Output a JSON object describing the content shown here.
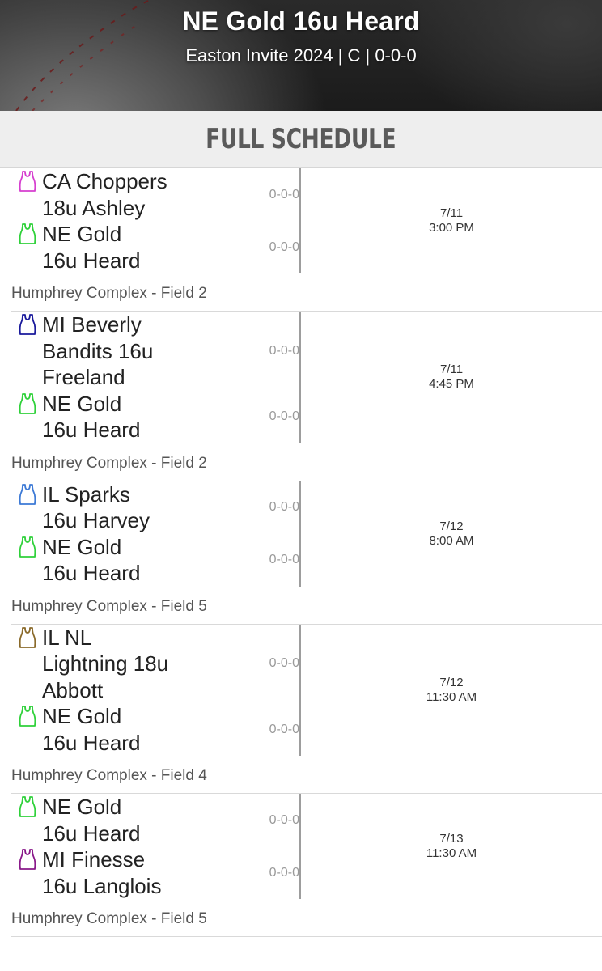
{
  "header": {
    "title": "NE Gold 16u Heard",
    "subtitle": "Easton Invite 2024 | C | 0-0-0"
  },
  "section": {
    "title": "FULL SCHEDULE"
  },
  "games": [
    {
      "teams": [
        {
          "name_lines": [
            "CA Choppers",
            "18u Ashley"
          ],
          "record": "0-0-0",
          "jersey_color": "#d63fcf"
        },
        {
          "name_lines": [
            "NE Gold",
            "16u Heard"
          ],
          "record": "0-0-0",
          "jersey_color": "#2fd13a"
        }
      ],
      "date": "7/11",
      "time": "3:00 PM",
      "location": "Humphrey Complex - Field 2"
    },
    {
      "teams": [
        {
          "name_lines": [
            "MI Beverly",
            "Bandits 16u",
            "Freeland"
          ],
          "record": "0-0-0",
          "jersey_color": "#1a1a9c"
        },
        {
          "name_lines": [
            "NE Gold",
            "16u Heard"
          ],
          "record": "0-0-0",
          "jersey_color": "#2fd13a"
        }
      ],
      "date": "7/11",
      "time": "4:45 PM",
      "location": "Humphrey Complex - Field 2"
    },
    {
      "teams": [
        {
          "name_lines": [
            "IL Sparks",
            "16u Harvey"
          ],
          "record": "0-0-0",
          "jersey_color": "#3d7ad6"
        },
        {
          "name_lines": [
            "NE Gold",
            "16u Heard"
          ],
          "record": "0-0-0",
          "jersey_color": "#2fd13a"
        }
      ],
      "date": "7/12",
      "time": "8:00 AM",
      "location": "Humphrey Complex - Field 5"
    },
    {
      "teams": [
        {
          "name_lines": [
            "IL NL",
            "Lightning 18u",
            "Abbott"
          ],
          "record": "0-0-0",
          "jersey_color": "#8a6a2a"
        },
        {
          "name_lines": [
            "NE Gold",
            "16u Heard"
          ],
          "record": "0-0-0",
          "jersey_color": "#2fd13a"
        }
      ],
      "date": "7/12",
      "time": "11:30 AM",
      "location": "Humphrey Complex - Field 4"
    },
    {
      "teams": [
        {
          "name_lines": [
            "NE Gold",
            "16u Heard"
          ],
          "record": "0-0-0",
          "jersey_color": "#2fd13a"
        },
        {
          "name_lines": [
            "MI Finesse",
            "16u Langlois"
          ],
          "record": "0-0-0",
          "jersey_color": "#8a1a8a"
        }
      ],
      "date": "7/13",
      "time": "11:30 AM",
      "location": "Humphrey Complex - Field 5"
    }
  ]
}
